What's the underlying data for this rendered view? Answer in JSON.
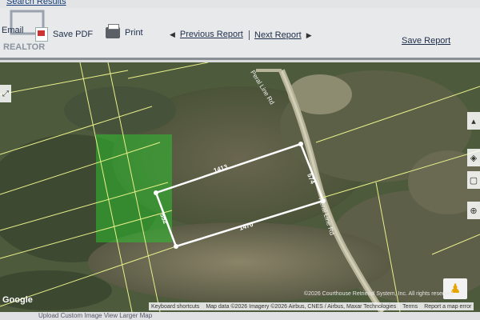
{
  "header": {
    "search_link": "Search Results"
  },
  "toolbar": {
    "email_label": "Email",
    "logo_text": "REALTOR",
    "save_pdf_label": "Save PDF",
    "print_label": "Print",
    "previous_label": "Previous Report",
    "next_label": "Next Report",
    "save_report_label": "Save Report"
  },
  "map": {
    "road_label_1": "Peral Line Rd",
    "road_label_2": "Neral Line Rd",
    "dims": {
      "top": "1413",
      "right": "574",
      "bottom": "1470",
      "left": "552"
    },
    "google_logo": "Google",
    "copyright": "©2026 Courthouse Retrieval System, Inc. All rights reserved",
    "attribution": {
      "shortcuts": "Keyboard shortcuts",
      "map_data": "Map data ©2026 Imagery ©2026 Airbus, CNES / Airbus, Maxar Technologies",
      "terms": "Terms",
      "report": "Report a map error"
    },
    "colors": {
      "parcel_outline": "#ffffff",
      "lot_lines": "#e8f08a",
      "highlight": "#2fbf2f"
    }
  },
  "footer": {
    "partial_text": "Upload Custom Image          View Larger Map"
  }
}
